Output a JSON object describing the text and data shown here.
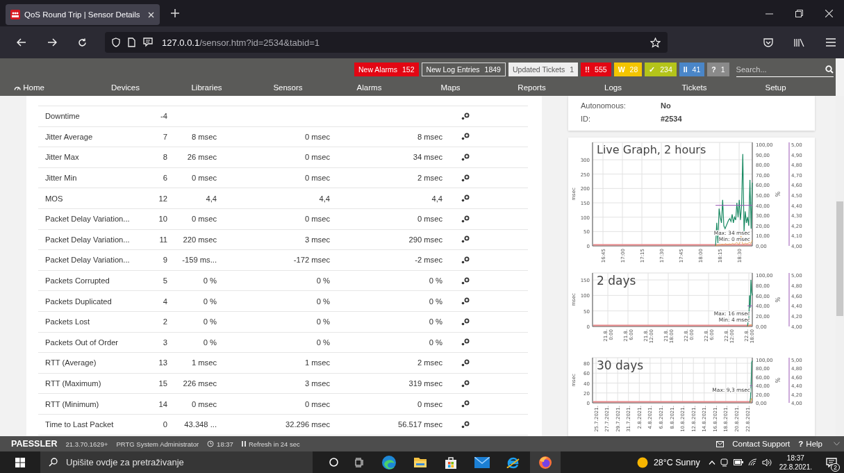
{
  "browser": {
    "tab_title": "QoS Round Trip | Sensor Details",
    "url_host": "127.0.0.1",
    "url_path": "/sensor.htm?id=2534&tabid=1"
  },
  "badges": [
    {
      "kind": "counter",
      "label": "New Alarms",
      "count": "152",
      "color": "#e30613"
    },
    {
      "kind": "counter",
      "label": "New Log Entries",
      "count": "1849",
      "color": "#5a5a58"
    },
    {
      "kind": "counter",
      "label": "Updated Tickets",
      "count": "1",
      "color": "#eeeeee"
    },
    {
      "kind": "status",
      "label": "!!",
      "count": "555",
      "color": "#e30613"
    },
    {
      "kind": "status",
      "label": "W",
      "count": "28",
      "color": "#f3c500"
    },
    {
      "kind": "status",
      "label": "✓",
      "count": "234",
      "color": "#b4c41a"
    },
    {
      "kind": "status",
      "label": "II",
      "count": "41",
      "color": "#4a86c8"
    },
    {
      "kind": "status",
      "label": "?",
      "count": "1",
      "color": "#8a8a8a"
    }
  ],
  "search": {
    "placeholder": "Search..."
  },
  "nav": [
    "Home",
    "Devices",
    "Libraries",
    "Sensors",
    "Alarms",
    "Maps",
    "Reports",
    "Logs",
    "Tickets",
    "Setup"
  ],
  "table": {
    "rows": [
      [
        "Downtime",
        "-4",
        "",
        "",
        ""
      ],
      [
        "Jitter Average",
        "7",
        "8 msec",
        "0 msec",
        "8 msec"
      ],
      [
        "Jitter Max",
        "8",
        "26 msec",
        "0 msec",
        "34 msec"
      ],
      [
        "Jitter Min",
        "6",
        "0 msec",
        "0 msec",
        "2 msec"
      ],
      [
        "MOS",
        "12",
        "4,4",
        "4,4",
        "4,4"
      ],
      [
        "Packet Delay Variation...",
        "10",
        "0 msec",
        "0 msec",
        "0 msec"
      ],
      [
        "Packet Delay Variation...",
        "11",
        "220 msec",
        "3 msec",
        "290 msec"
      ],
      [
        "Packet Delay Variation...",
        "9",
        "-159 ms...",
        "-172 msec",
        "-2 msec"
      ],
      [
        "Packets Corrupted",
        "5",
        "0 %",
        "0 %",
        "0 %"
      ],
      [
        "Packets Duplicated",
        "4",
        "0 %",
        "0 %",
        "0 %"
      ],
      [
        "Packets Lost",
        "2",
        "0 %",
        "0 %",
        "0 %"
      ],
      [
        "Packets Out of Order",
        "3",
        "0 %",
        "0 %",
        "0 %"
      ],
      [
        "RTT (Average)",
        "13",
        "1 msec",
        "1 msec",
        "2 msec"
      ],
      [
        "RTT (Maximum)",
        "15",
        "226 msec",
        "3 msec",
        "319 msec"
      ],
      [
        "RTT (Minimum)",
        "14",
        "0 msec",
        "0 msec",
        "0 msec"
      ],
      [
        "Time to Last Packet",
        "0",
        "43.348 ...",
        "32.296 msec",
        "56.517 msec"
      ]
    ]
  },
  "details": [
    {
      "label": "Autonomous:",
      "value": "No"
    },
    {
      "label": "ID:",
      "value": "#2534"
    }
  ],
  "graphs": [
    {
      "title": "Live Graph, 2 hours",
      "y_label": "msec",
      "y_ticks": [
        "300",
        "250",
        "200",
        "150",
        "100",
        "50",
        "0"
      ],
      "right_label": "%",
      "right_ticks": [
        "100,00",
        "90,00",
        "80,00",
        "70,00",
        "60,00",
        "50,00",
        "40,00",
        "30,00",
        "20,00",
        "10,00",
        "0,00"
      ],
      "purple_ticks": [
        "5,00",
        "4,90",
        "4,80",
        "4,70",
        "4,60",
        "4,50",
        "4,40",
        "4,30",
        "4,20",
        "4,10",
        "4,00"
      ],
      "x_ticks": [
        [
          "16:45"
        ],
        [
          "17:00"
        ],
        [
          "17:15"
        ],
        [
          "17:30"
        ],
        [
          "17:45"
        ],
        [
          "18:00"
        ],
        [
          "18:15"
        ],
        [
          "18:30"
        ]
      ],
      "notes": [
        "Max: 34 msec",
        "Min: 0 msec"
      ]
    },
    {
      "title": "2 days",
      "y_label": "msec",
      "y_ticks": [
        "150",
        "100",
        "50",
        "0"
      ],
      "right_label": "%",
      "right_ticks": [
        "100,00",
        "80,00",
        "60,00",
        "40,00",
        "20,00",
        "0,00"
      ],
      "purple_ticks": [
        "5,00",
        "4,80",
        "4,60",
        "4,40",
        "4,20",
        "4,00"
      ],
      "x_ticks": [
        [
          "21.8.",
          "0:00"
        ],
        [
          "21.8.",
          "6:00"
        ],
        [
          "21.8.",
          "12:00"
        ],
        [
          "21.8.",
          "18:00"
        ],
        [
          "22.8.",
          "0:00"
        ],
        [
          "22.8.",
          "6:00"
        ],
        [
          "22.8.",
          "12:00"
        ],
        [
          "22.8.",
          "18:00"
        ]
      ],
      "notes": [
        "Max: 16 msec",
        "Min: 4 msec"
      ]
    },
    {
      "title": "30 days",
      "y_label": "msec",
      "y_ticks": [
        "80",
        "60",
        "40",
        "20",
        "0"
      ],
      "right_label": "%",
      "right_ticks": [
        "100,00",
        "80,00",
        "60,00",
        "40,00",
        "20,00",
        "0,00"
      ],
      "purple_ticks": [
        "5,00",
        "4,80",
        "4,60",
        "4,40",
        "4,20",
        "4,00"
      ],
      "x_ticks": [
        [
          "25.7.2021."
        ],
        [
          "27.7.2021."
        ],
        [
          "29.7.2021."
        ],
        [
          "31.7.2021."
        ],
        [
          "2.8.2021."
        ],
        [
          "4.8.2021."
        ],
        [
          "6.8.2021."
        ],
        [
          "8.8.2021."
        ],
        [
          "10.8.2021."
        ],
        [
          "12.8.2021."
        ],
        [
          "14.8.2021."
        ],
        [
          "16.8.2021."
        ],
        [
          "18.8.2021."
        ],
        [
          "20.8.2021."
        ],
        [
          "22.8.2021."
        ]
      ],
      "notes": [
        "Max: 9,3 msec"
      ]
    }
  ],
  "status_bar": {
    "brand": "PAESSLER",
    "version": "21.3.70.1629+",
    "user": "PRTG System Administrator",
    "time": "18:37",
    "refresh": "Refresh in 24 sec",
    "contact": "Contact Support",
    "help_mark": "?",
    "help": "Help"
  },
  "taskbar": {
    "search_placeholder": "Upišite ovdje za pretraživanje",
    "weather": "28°C Sunny",
    "time": "18:37",
    "date": "22.8.2021.",
    "notifications": "2"
  }
}
